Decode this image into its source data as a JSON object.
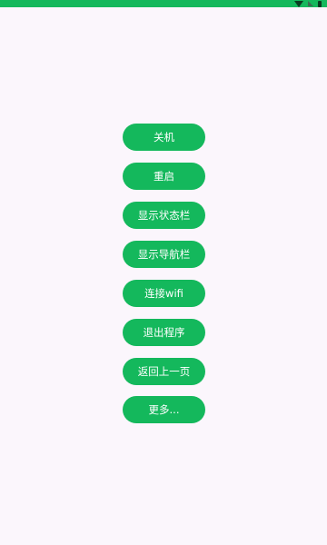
{
  "colors": {
    "background": "#fbf6fc",
    "accent": "#14b85c",
    "button_text": "#ffffff"
  },
  "status_bar": {
    "icons": [
      "wifi-icon",
      "signal-icon",
      "battery-icon"
    ]
  },
  "buttons": {
    "shutdown": "关机",
    "restart": "重启",
    "show_status_bar": "显示状态栏",
    "show_nav_bar": "显示导航栏",
    "connect_wifi": "连接wifi",
    "exit_program": "退出程序",
    "go_back": "返回上一页",
    "more": "更多..."
  }
}
